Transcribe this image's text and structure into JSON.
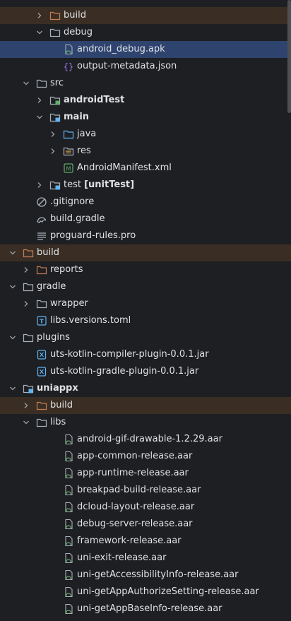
{
  "colors": {
    "background": "#1e1f22",
    "selected_row": "#2e436e",
    "excluded_row": "#3a2e24",
    "folder": "#a9b1bc",
    "excluded_folder": "#c27d55",
    "source_folder": "#5fb3f5",
    "test_folder": "#5fae6c",
    "text": "#dfe1e5"
  },
  "tree": [
    {
      "label": "build",
      "depth": 2,
      "arrow": "right",
      "icon": "excluded-folder-icon",
      "style": "excluded"
    },
    {
      "label": "debug",
      "depth": 2,
      "arrow": "down",
      "icon": "folder-icon"
    },
    {
      "label": "android_debug.apk",
      "depth": 3,
      "icon": "apk-file-icon",
      "style": "selected"
    },
    {
      "label": "output-metadata.json",
      "depth": 3,
      "icon": "json-file-icon"
    },
    {
      "label": "src",
      "depth": 1,
      "arrow": "down",
      "icon": "folder-icon"
    },
    {
      "label": "androidTest",
      "depth": 2,
      "arrow": "right",
      "icon": "test-module-folder-icon",
      "bold": true
    },
    {
      "label": "main",
      "depth": 2,
      "arrow": "down",
      "icon": "module-folder-icon",
      "bold": true
    },
    {
      "label": "java",
      "depth": 3,
      "arrow": "right",
      "icon": "source-folder-icon"
    },
    {
      "label": "res",
      "depth": 3,
      "arrow": "right",
      "icon": "resource-folder-icon"
    },
    {
      "label": "AndroidManifest.xml",
      "depth": 3,
      "icon": "manifest-file-icon"
    },
    {
      "label": "test",
      "suffix": "[unitTest]",
      "depth": 2,
      "arrow": "right",
      "icon": "module-folder-icon"
    },
    {
      "label": ".gitignore",
      "depth": 1,
      "icon": "gitignore-file-icon"
    },
    {
      "label": "build.gradle",
      "depth": 1,
      "icon": "gradle-file-icon"
    },
    {
      "label": "proguard-rules.pro",
      "depth": 1,
      "icon": "text-file-icon"
    },
    {
      "label": "build",
      "depth": 0,
      "arrow": "down",
      "icon": "excluded-folder-icon",
      "style": "excluded"
    },
    {
      "label": "reports",
      "depth": 1,
      "arrow": "right",
      "icon": "excluded-folder-icon"
    },
    {
      "label": "gradle",
      "depth": 0,
      "arrow": "down",
      "icon": "folder-icon"
    },
    {
      "label": "wrapper",
      "depth": 1,
      "arrow": "right",
      "icon": "folder-icon"
    },
    {
      "label": "libs.versions.toml",
      "depth": 1,
      "icon": "toml-file-icon"
    },
    {
      "label": "plugins",
      "depth": 0,
      "arrow": "down",
      "icon": "folder-icon"
    },
    {
      "label": "uts-kotlin-compiler-plugin-0.0.1.jar",
      "depth": 1,
      "icon": "jar-file-icon"
    },
    {
      "label": "uts-kotlin-gradle-plugin-0.0.1.jar",
      "depth": 1,
      "icon": "jar-file-icon"
    },
    {
      "label": "uniappx",
      "depth": 0,
      "arrow": "down",
      "icon": "module-folder-icon",
      "bold": true
    },
    {
      "label": "build",
      "depth": 1,
      "arrow": "right",
      "icon": "excluded-folder-icon",
      "style": "excluded"
    },
    {
      "label": "libs",
      "depth": 1,
      "arrow": "down",
      "icon": "folder-icon"
    },
    {
      "label": "android-gif-drawable-1.2.29.aar",
      "depth": 3,
      "icon": "aar-file-icon"
    },
    {
      "label": "app-common-release.aar",
      "depth": 3,
      "icon": "aar-file-icon"
    },
    {
      "label": "app-runtime-release.aar",
      "depth": 3,
      "icon": "aar-file-icon"
    },
    {
      "label": "breakpad-build-release.aar",
      "depth": 3,
      "icon": "aar-file-icon"
    },
    {
      "label": "dcloud-layout-release.aar",
      "depth": 3,
      "icon": "aar-file-icon"
    },
    {
      "label": "debug-server-release.aar",
      "depth": 3,
      "icon": "aar-file-icon"
    },
    {
      "label": "framework-release.aar",
      "depth": 3,
      "icon": "aar-file-icon"
    },
    {
      "label": "uni-exit-release.aar",
      "depth": 3,
      "icon": "aar-file-icon"
    },
    {
      "label": "uni-getAccessibilityInfo-release.aar",
      "depth": 3,
      "icon": "aar-file-icon"
    },
    {
      "label": "uni-getAppAuthorizeSetting-release.aar",
      "depth": 3,
      "icon": "aar-file-icon"
    },
    {
      "label": "uni-getAppBaseInfo-release.aar",
      "depth": 3,
      "icon": "aar-file-icon"
    }
  ]
}
